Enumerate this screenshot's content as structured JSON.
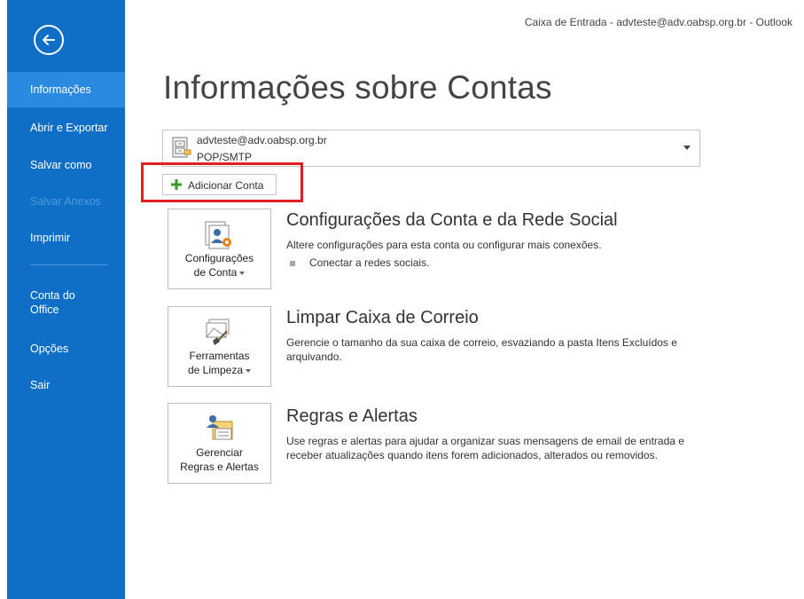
{
  "window": {
    "title": "Caixa de Entrada - advteste@adv.oabsp.org.br - Outlook"
  },
  "sidebar": {
    "back_icon": "back-arrow-icon",
    "items": [
      {
        "label": "Informações",
        "state": "active"
      },
      {
        "label": "Abrir e Exportar",
        "state": "normal"
      },
      {
        "label": "Salvar como",
        "state": "normal"
      },
      {
        "label": "Salvar Anexos",
        "state": "disabled"
      },
      {
        "label": "Imprimir",
        "state": "normal"
      },
      {
        "label": "Conta do Office",
        "state": "normal"
      },
      {
        "label": "Opções",
        "state": "normal"
      },
      {
        "label": "Sair",
        "state": "normal"
      }
    ],
    "color": "#0f6fc6",
    "active_color": "#2a8ae0"
  },
  "page": {
    "title": "Informações sobre Contas"
  },
  "account": {
    "email": "advteste@adv.oabsp.org.br",
    "type": "POP/SMTP"
  },
  "add_account": {
    "label": "Adicionar Conta",
    "highlight_color": "#e02020"
  },
  "sections": [
    {
      "button_line1": "Configurações",
      "button_line2": "de Conta",
      "title": "Configurações da Conta e da Rede Social",
      "description": "Altere configurações para esta conta ou configurar mais conexões.",
      "bullet": "Conectar a redes sociais."
    },
    {
      "button_line1": "Ferramentas",
      "button_line2": "de Limpeza",
      "title": "Limpar Caixa de Correio",
      "description": "Gerencie o tamanho da sua caixa de correio, esvaziando a pasta Itens Excluídos e arquivando."
    },
    {
      "button_line1": "Gerenciar",
      "button_line2": "Regras e Alertas",
      "title": "Regras e Alertas",
      "description": "Use regras e alertas para ajudar a organizar suas mensagens de email de entrada e receber atualizações quando itens forem adicionados, alterados ou removidos."
    }
  ]
}
